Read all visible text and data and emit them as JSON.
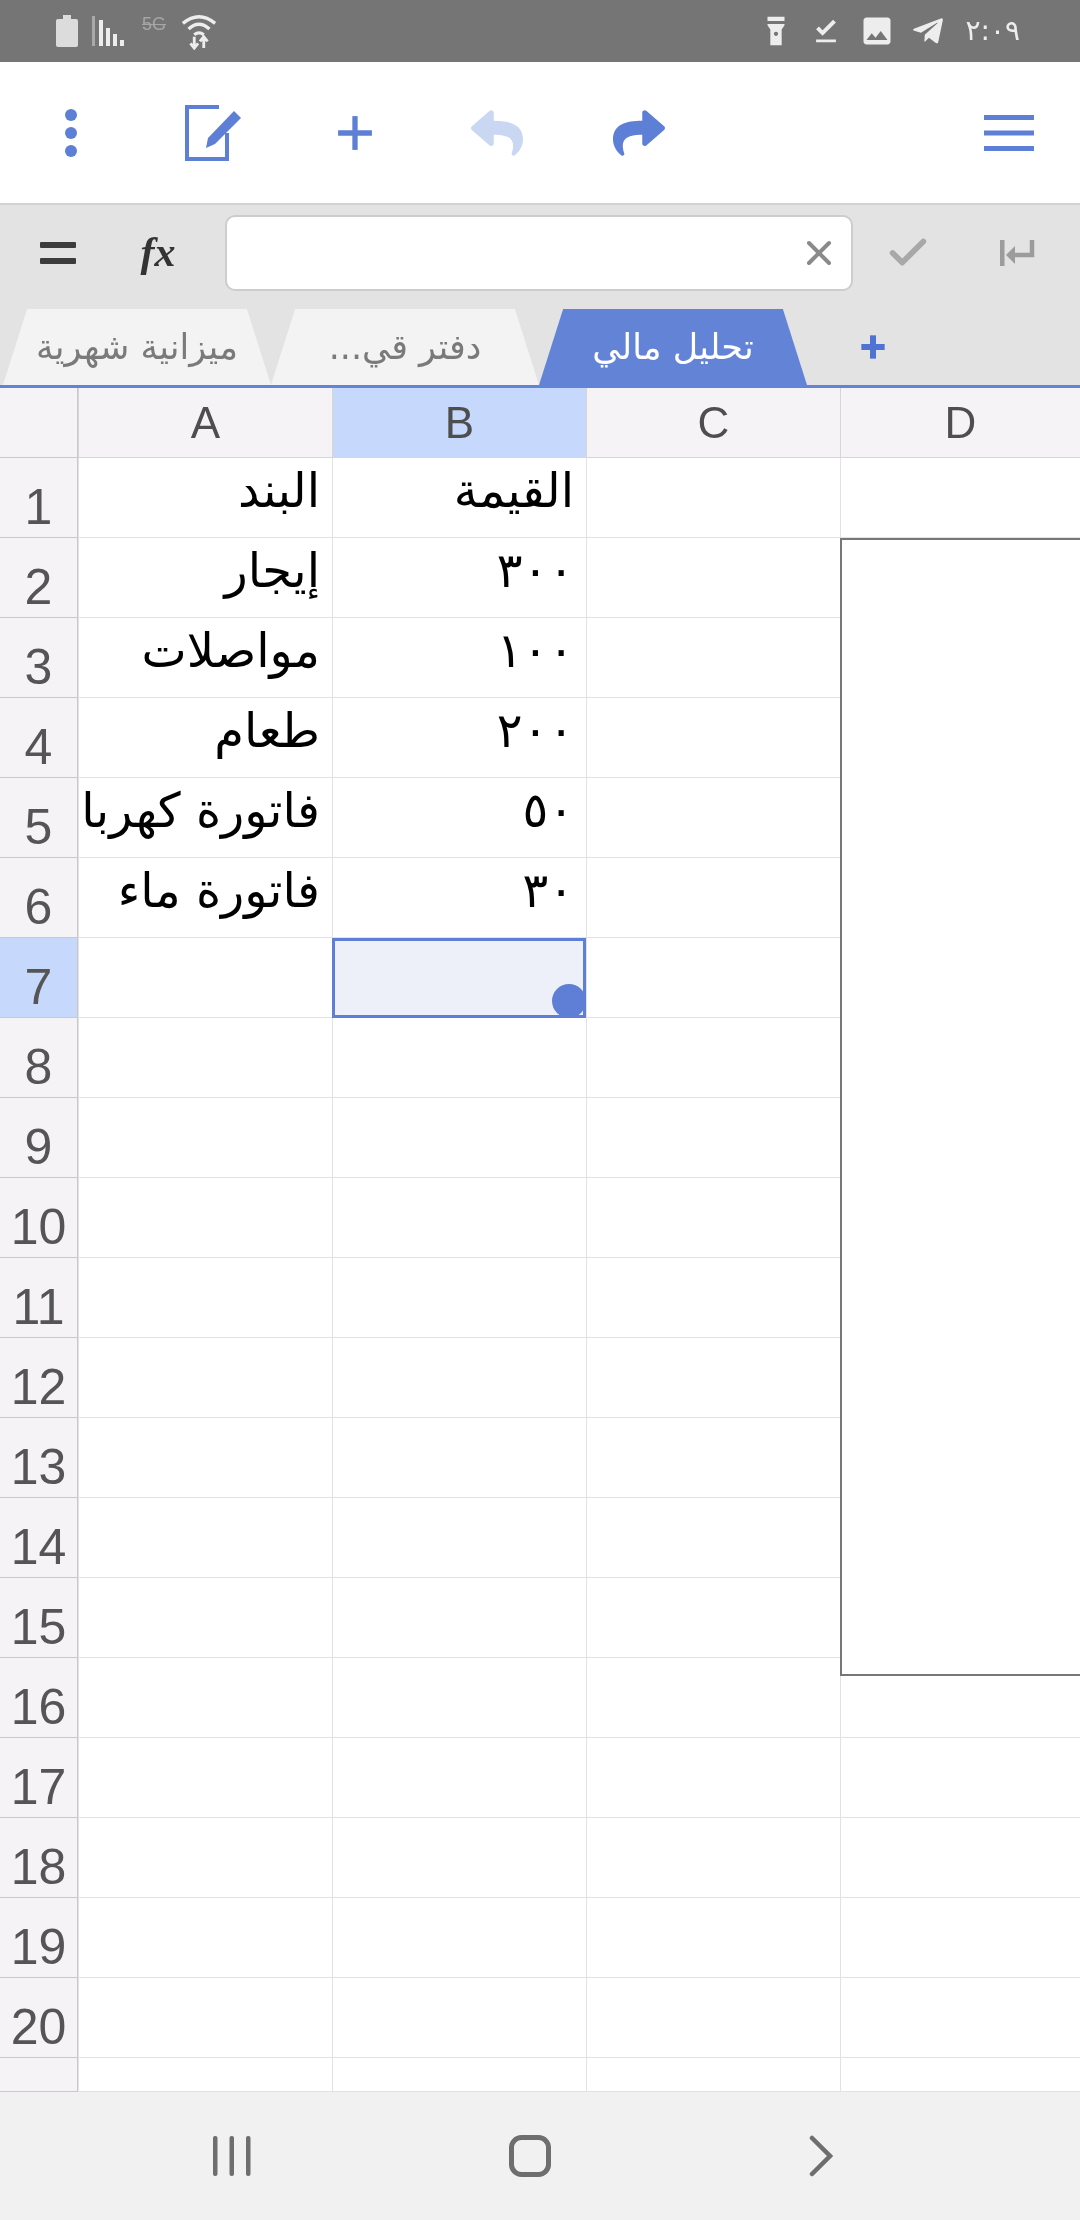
{
  "status_bar": {
    "network": "5G",
    "time": "٢:٠٩"
  },
  "toolbar": [
    {
      "kind": "more",
      "disabled": false
    },
    {
      "kind": "edit",
      "disabled": false
    },
    {
      "kind": "add",
      "disabled": false
    },
    {
      "kind": "undo",
      "disabled": true
    },
    {
      "kind": "redo",
      "disabled": false
    },
    {
      "kind": "menu",
      "disabled": false
    }
  ],
  "formula_bar": {
    "function_label": "fx"
  },
  "sheet_tabs": [
    {
      "label": "تحليل مالي",
      "selected": true
    },
    {
      "label": "دفتر قي...",
      "selected": false
    },
    {
      "label": "ميزانية شهرية",
      "selected": false
    }
  ],
  "columns": [
    {
      "label": "D",
      "selected": false
    },
    {
      "label": "C",
      "selected": false
    },
    {
      "label": "B",
      "selected": true
    },
    {
      "label": "A",
      "selected": false
    }
  ],
  "rows": [
    {
      "label": "1",
      "selected": false,
      "cells": [
        {
          "selected": false
        },
        {
          "selected": false
        },
        {
          "text": "القيمة",
          "selected": false
        },
        {
          "text": "البند",
          "selected": false
        }
      ]
    },
    {
      "label": "2",
      "selected": false,
      "cells": [
        {
          "selected": false
        },
        {
          "text": "٣٠٠",
          "selected": false
        },
        {
          "text": "إيجار",
          "selected": false
        }
      ]
    },
    {
      "label": "3",
      "selected": false,
      "cells": [
        {
          "selected": false
        },
        {
          "text": "١٠٠",
          "selected": false
        },
        {
          "text": "مواصلات",
          "selected": false
        }
      ]
    },
    {
      "label": "4",
      "selected": false,
      "cells": [
        {
          "selected": false
        },
        {
          "text": "٢٠٠",
          "selected": false
        },
        {
          "text": "طعام",
          "selected": false
        }
      ]
    },
    {
      "label": "5",
      "selected": false,
      "cells": [
        {
          "selected": false
        },
        {
          "text": "٥٠",
          "selected": false
        },
        {
          "text": "فاتورة كهربا",
          "selected": false
        }
      ]
    },
    {
      "label": "6",
      "selected": false,
      "cells": [
        {
          "selected": false
        },
        {
          "text": "٣٠",
          "selected": false
        },
        {
          "text": "فاتورة ماء",
          "selected": false
        }
      ]
    },
    {
      "label": "7",
      "selected": true,
      "cells": [
        {
          "selected": false
        },
        {
          "selected": true
        },
        {
          "selected": false
        }
      ]
    },
    {
      "label": "8",
      "selected": false,
      "cells": [
        {
          "selected": false
        },
        {
          "selected": false
        },
        {
          "selected": false
        }
      ]
    },
    {
      "label": "9",
      "selected": false,
      "cells": [
        {
          "selected": false
        },
        {
          "selected": false
        },
        {
          "selected": false
        }
      ]
    },
    {
      "label": "10",
      "selected": false,
      "cells": [
        {
          "selected": false
        },
        {
          "selected": false
        },
        {
          "selected": false
        }
      ]
    },
    {
      "label": "11",
      "selected": false,
      "cells": [
        {
          "selected": false
        },
        {
          "selected": false
        },
        {
          "selected": false
        }
      ]
    },
    {
      "label": "12",
      "selected": false,
      "cells": [
        {
          "selected": false
        },
        {
          "selected": false
        },
        {
          "selected": false
        }
      ]
    },
    {
      "label": "13",
      "selected": false,
      "cells": [
        {
          "selected": false
        },
        {
          "selected": false
        },
        {
          "selected": false
        }
      ]
    },
    {
      "label": "14",
      "selected": false,
      "cells": [
        {
          "selected": false
        },
        {
          "selected": false
        },
        {
          "selected": false
        }
      ]
    },
    {
      "label": "15",
      "selected": false,
      "cells": [
        {
          "selected": false
        },
        {
          "selected": false
        },
        {
          "selected": false
        }
      ]
    },
    {
      "label": "16",
      "selected": false,
      "cells": [
        {
          "selected": false
        },
        {
          "selected": false
        },
        {
          "selected": false
        },
        {
          "selected": false
        }
      ]
    },
    {
      "label": "17",
      "selected": false,
      "cells": [
        {
          "selected": false
        },
        {
          "selected": false
        },
        {
          "selected": false
        },
        {
          "selected": false
        }
      ]
    },
    {
      "label": "18",
      "selected": false,
      "cells": [
        {
          "selected": false
        },
        {
          "selected": false
        },
        {
          "selected": false
        },
        {
          "selected": false
        }
      ]
    },
    {
      "label": "19",
      "selected": false,
      "cells": [
        {
          "selected": false
        },
        {
          "selected": false
        },
        {
          "selected": false
        },
        {
          "selected": false
        }
      ]
    },
    {
      "label": "20",
      "selected": false,
      "cells": [
        {
          "selected": false
        },
        {
          "selected": false
        },
        {
          "selected": false
        },
        {
          "selected": false
        }
      ]
    },
    {
      "selected": false,
      "cells": [
        {
          "selected": false
        },
        {
          "selected": false
        },
        {
          "selected": false
        },
        {
          "selected": false
        }
      ]
    }
  ]
}
